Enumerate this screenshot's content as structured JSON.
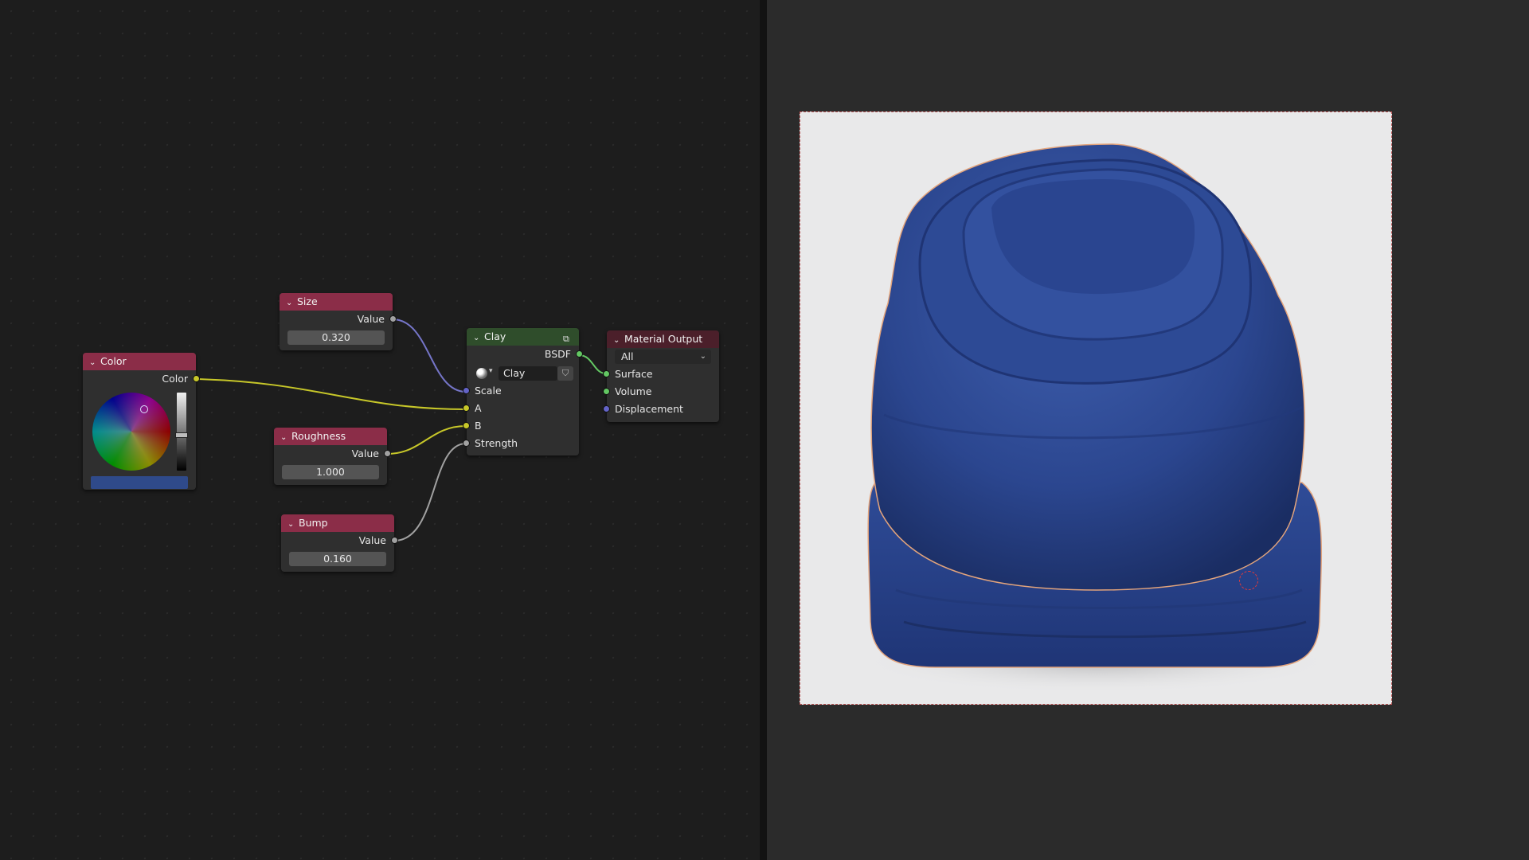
{
  "node_editor": {
    "nodes": {
      "color": {
        "title": "Color",
        "output": "Color",
        "swatch_color": "#2f4a8a"
      },
      "size": {
        "title": "Size",
        "output": "Value",
        "value": "0.320"
      },
      "roughness": {
        "title": "Roughness",
        "output": "Value",
        "value": "1.000"
      },
      "bump": {
        "title": "Bump",
        "output": "Value",
        "value": "0.160"
      },
      "clay": {
        "title": "Clay",
        "output": "BSDF",
        "material": "Clay",
        "inputs": [
          "Scale",
          "A",
          "B",
          "Strength"
        ]
      },
      "material_output": {
        "title": "Material Output",
        "target": "All",
        "inputs": [
          "Surface",
          "Volume",
          "Displacement"
        ]
      }
    },
    "socket_colors": {
      "float": "#a1a1a1",
      "color": "#c7c729",
      "shader": "#63c763",
      "vector": "#6363c7"
    },
    "header_colors": {
      "input": "#8b2d48",
      "shader": "#2f4d2b",
      "output": "#4b1f2a"
    }
  },
  "viewport": {
    "render_background": "#e9e9ea",
    "object_color": "#2f4a8a",
    "cursor": "3d-cursor-icon"
  }
}
